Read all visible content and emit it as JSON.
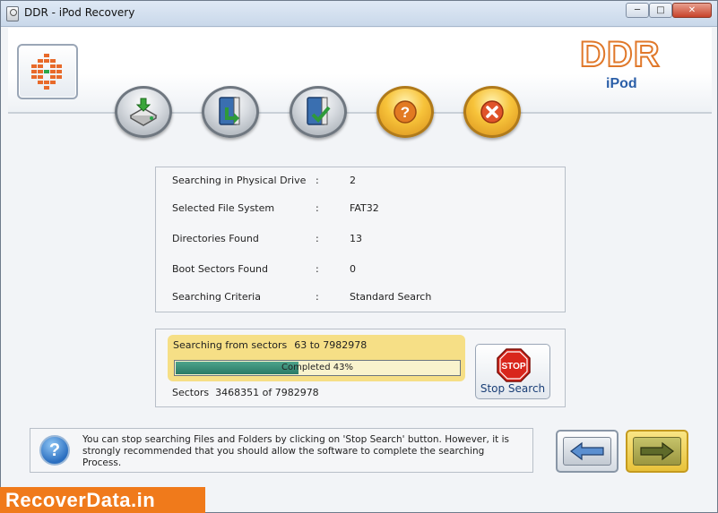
{
  "window": {
    "title": "DDR - iPod Recovery"
  },
  "header": {
    "brand": "DDR",
    "product": "iPod"
  },
  "toolbar": {
    "buttons": [
      {
        "name": "save-data-button",
        "icon": "drive-download-icon"
      },
      {
        "name": "open-button",
        "icon": "book-arrow-icon"
      },
      {
        "name": "verify-button",
        "icon": "book-check-icon"
      },
      {
        "name": "help-button",
        "icon": "question-icon"
      },
      {
        "name": "exit-button",
        "icon": "close-icon"
      }
    ]
  },
  "info": {
    "rows": [
      {
        "label": "Searching in Physical Drive",
        "sep": ":",
        "value": "2"
      },
      {
        "label": "Selected File System",
        "sep": ":",
        "value": "FAT32"
      },
      {
        "label": "Directories Found",
        "sep": ":",
        "value": "13"
      },
      {
        "label": "Boot Sectors Found",
        "sep": ":",
        "value": "0"
      },
      {
        "label": "Searching Criteria",
        "sep": ":",
        "value": "Standard Search"
      }
    ]
  },
  "progress": {
    "label": "Searching from sectors",
    "range": "63 to 7982978",
    "percent": 43,
    "status": "Completed 43%",
    "sectors_label": "Sectors",
    "sectors_value": "3468351 of 7982978"
  },
  "stop": {
    "sign_text": "STOP",
    "label": "Stop Search"
  },
  "help": {
    "text": "You can stop searching Files and Folders by clicking on 'Stop Search' button. However, it is strongly recommended that you should allow the software to complete the searching Process."
  },
  "watermark": {
    "text": "RecoverData.in"
  },
  "colors": {
    "accent": "#f07a1b",
    "progress_fill": "#2a7a66",
    "highlight": "#f6df86"
  }
}
